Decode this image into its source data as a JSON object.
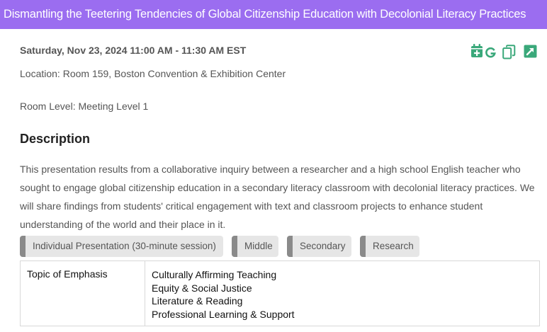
{
  "session": {
    "title": "Dismantling the Teetering Tendencies of Global Citizenship Education with Decolonial Literacy Practices",
    "datetime": "Saturday, Nov 23, 2024 11:00 AM - 11:30 AM EST",
    "location": "Location: Room 159, Boston Convention & Exhibition Center",
    "room_level": "Room Level: Meeting Level 1"
  },
  "actions": {
    "icons": [
      "calendar-add-icon",
      "google-calendar-icon",
      "copy-icon",
      "open-external-icon"
    ],
    "accent_color": "#3aa87a"
  },
  "description": {
    "heading": "Description",
    "text": "This presentation results from a collaborative inquiry between a researcher and a high school English teacher who sought to engage global citizenship education in a secondary literacy classroom with decolonial literacy practices. We will share findings from students' critical engagement with text and classroom projects to enhance student understanding of the world and their place in it."
  },
  "tags": [
    "Individual Presentation (30-minute session)",
    "Middle",
    "Secondary",
    "Research"
  ],
  "topics": {
    "label": "Topic of Emphasis",
    "values": [
      "Culturally Affirming Teaching",
      "Equity & Social Justice",
      "Literature & Reading",
      "Professional Learning & Support"
    ]
  },
  "colors": {
    "title_bar": "#9b6df0",
    "tag_background": "#e6e6e6",
    "tag_accent": "#8a8a8a"
  }
}
